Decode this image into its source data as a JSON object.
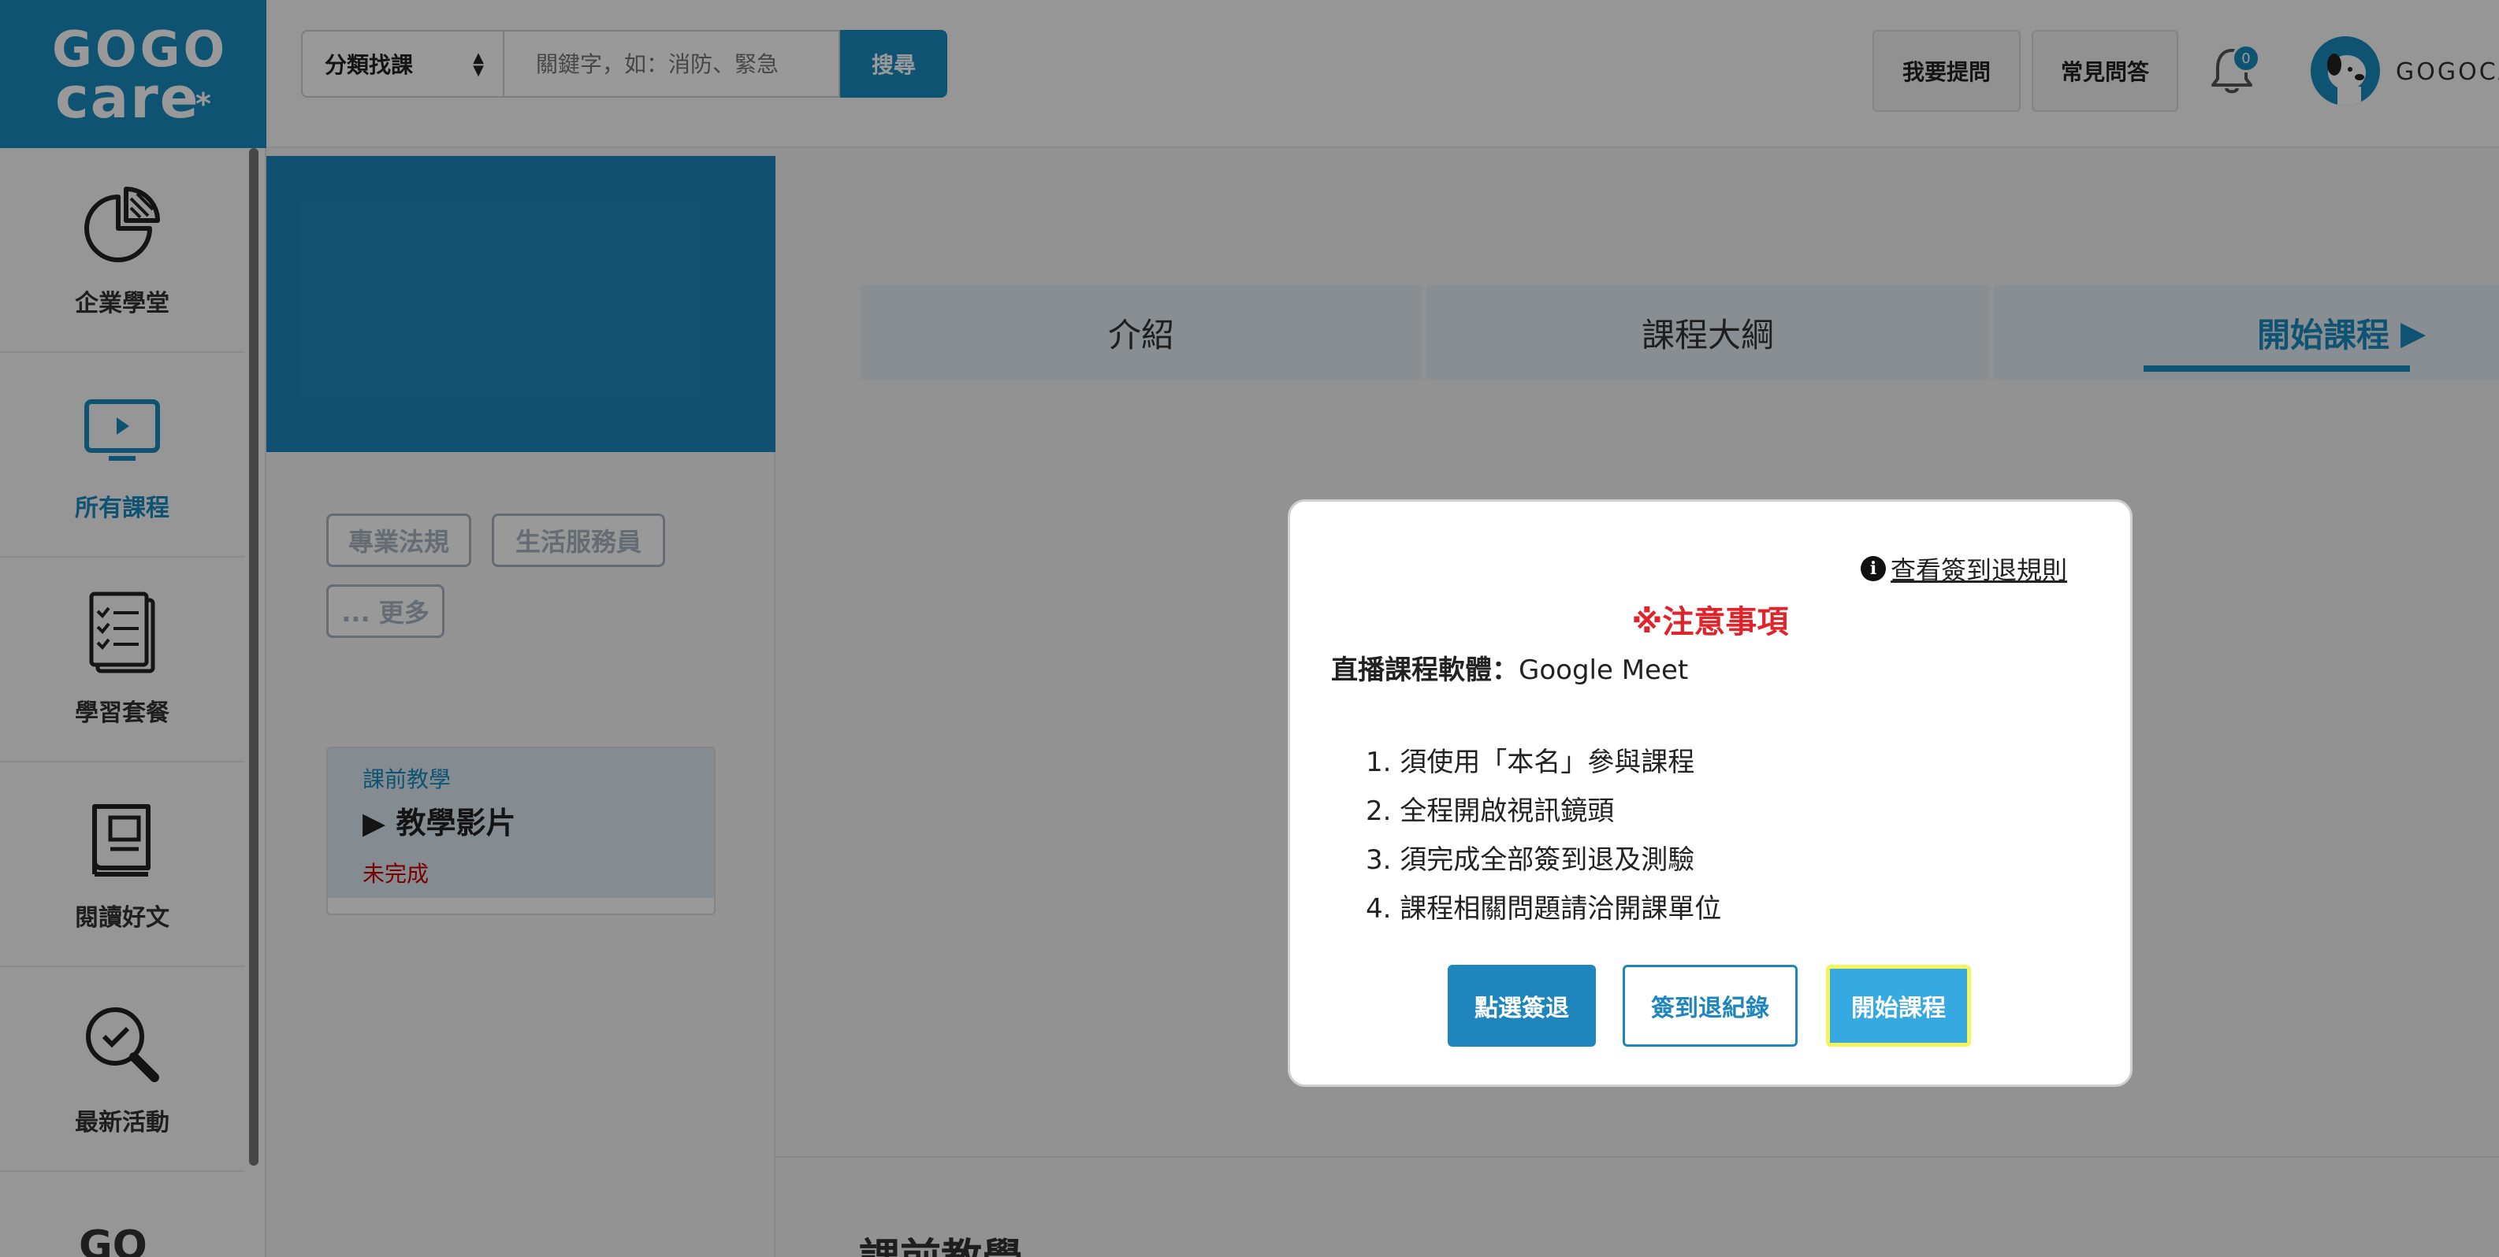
{
  "header": {
    "logo_top": "GOGO",
    "logo_bottom": "care",
    "logo_mark": "*",
    "category_select": "分類找課",
    "search_placeholder": "關鍵字，如：消防、緊急",
    "search_button": "搜尋",
    "ask_button": "我要提問",
    "faq_button": "常見問答",
    "notification_count": "0",
    "user_name": "GOGOCA"
  },
  "sidebar": {
    "items": [
      {
        "label": "企業學堂",
        "icon": "pie-chart-icon"
      },
      {
        "label": "所有課程",
        "icon": "monitor-play-icon"
      },
      {
        "label": "學習套餐",
        "icon": "checklist-icon"
      },
      {
        "label": "閱讀好文",
        "icon": "book-icon"
      },
      {
        "label": "最新活動",
        "icon": "magnifier-check-icon"
      }
    ],
    "partial_logo": "GO"
  },
  "course": {
    "tags": [
      "專業法規",
      "生活服務員",
      "... 更多"
    ],
    "lesson": {
      "category": "課前教學",
      "title": "教學影片",
      "status": "未完成"
    }
  },
  "tabs": [
    "介紹",
    "課程大綱",
    "開始課程"
  ],
  "modal": {
    "rules_link": "查看簽到退規則",
    "notice": "※注意事項",
    "software_label": "直播課程軟體：",
    "software_value": "Google Meet",
    "rules": [
      "1. 須使用「本名」參與課程",
      "2. 全程開啟視訊鏡頭",
      "3. 須完成全部簽到退及測驗",
      "4. 課程相關問題請洽開課單位"
    ],
    "btn_sign": "點選簽退",
    "btn_record": "簽到退紀錄",
    "btn_start": "開始課程"
  },
  "section_title": "課前教學",
  "colors": {
    "primary": "#1a8ac0",
    "start_button": "#35a9e0",
    "highlight_border": "#f4f55a",
    "notice_red": "#e0242b"
  }
}
